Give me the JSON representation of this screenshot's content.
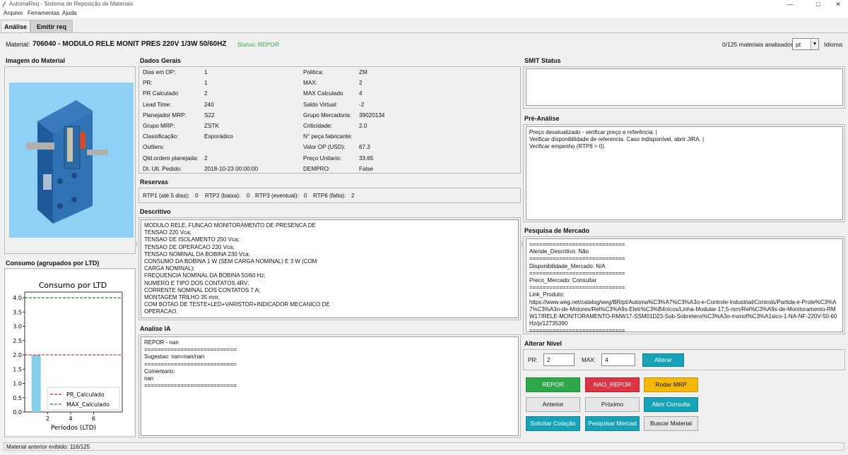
{
  "window": {
    "title": "AutomaReq - Sistema de Reposição de Materiais"
  },
  "menu": [
    "Arquivo",
    "Ferramentas",
    "Ajuda"
  ],
  "tabs": [
    "Análise",
    "Emitir req"
  ],
  "header": {
    "material_label": "Material:",
    "material_title": "706040 - MODULO RELE MONIT PRES 220V 1/3W 50/60HZ",
    "status": "Status: REPOR",
    "progress": "0/125 materiais analisados",
    "language_value": "pt",
    "language_label": "Idioma:"
  },
  "sections": {
    "image": "Imagem do Material",
    "consumption": "Consumo (agrupados por LTD)",
    "general": "Dados Gerais",
    "reserves": "Reservas",
    "description": "Descritivo",
    "ai": "Analise IA",
    "smit": "SMIT Status",
    "pre": "Pré-Análise",
    "market": "Pesquisa de Mercado",
    "level": "Alterar Nível"
  },
  "general_left": [
    {
      "label": "Dias em OP:",
      "value": "1"
    },
    {
      "label": "PR:",
      "value": "1"
    },
    {
      "label": "PR Calculado",
      "value": "2"
    },
    {
      "label": "Lead Time:",
      "value": "240"
    },
    {
      "label": "Planejador MRP:",
      "value": "S22"
    },
    {
      "label": "Grupo MRP:",
      "value": "ZSTK"
    },
    {
      "label": "Classificação:",
      "value": "Esporádico"
    },
    {
      "label": "Outliers:",
      "value": ""
    },
    {
      "label": "Qtd.ordem planejada:",
      "value": "2"
    },
    {
      "label": "Dt. Ult. Pedido:",
      "value": "2018-10-23 00:00:00"
    }
  ],
  "general_right": [
    {
      "label": "Politica:",
      "value": "ZM"
    },
    {
      "label": "MAX:",
      "value": "2"
    },
    {
      "label": "MAX Calculado",
      "value": "4"
    },
    {
      "label": "Saldo Virtual:",
      "value": "-2"
    },
    {
      "label": "Grupo Mercadoria:",
      "value": "39020134"
    },
    {
      "label": "Criticidade:",
      "value": "2.0"
    },
    {
      "label": "N° peça fabricante:",
      "value": ""
    },
    {
      "label": "Valor OP (USD):",
      "value": "67.3"
    },
    {
      "label": "Preço Unitario:",
      "value": "33.65"
    },
    {
      "label": "DEMPRO:",
      "value": "False"
    }
  ],
  "reserves": [
    {
      "label": "RTP1 (até 5 dias):",
      "value": "0"
    },
    {
      "label": "RTP2 (baixa):",
      "value": "0"
    },
    {
      "label": "RTP3 (eventual):",
      "value": "0"
    },
    {
      "label": "RTP6 (falta):",
      "value": "2"
    }
  ],
  "description_text": "MODULO RELE, FUNCAO MONITORAMENTO DE PRESENCA DE\nTENSAO 220 Vca;\nTENSAO DE ISOLAMENTO 250 Vca;\nTENSAO DE OPERACAO 220 Vca;\nTENSAO NOMINAL DA BOBINA 230 Vca;\nCONSUMO DA BOBINA 1 W (SEM CARGA NOMINAL) E 3 W (COM\nCARGA NOMINAL);\nFREQUENCIA NOMINAL DA BOBINA 50/60 Hz;\nNUMERO E TIPO DOS CONTATOS 4RV;\nCORRENTE NOMINAL DOS CONTATOS 7 A;\nMONTAGEM TRILHO 35 mm;\nCOM BOTAO DE TESTE+LED+VARISTOR+INDICADOR MECANICO DE\nOPERACAO.",
  "ai_text": "REPOR - nan\n============================\nSugestao: nan=nan/nan\n============================\nComentario:\nnan\n============================",
  "smit_text": "",
  "pre_text": "Preço desatualizado - verificar preço e referência. |\nVerificar disponibilidade de referencia. Caso indisponível, abrir JIRA. |\nVerificar empenho (RTP6 > 0).",
  "market_text": "=============================\nAtende_Descritivo: Não\n=============================\nDisponibilidade_Mercado: N/A\n=============================\nPreco_Mercado: Consultar\n=============================\nLink_Produto:\nhttps://www.weg.net/catalog/weg/BR/pt/Automa%C3%A7%C3%A3o-e-Controle-Industrial/Controls/Partida-e-Prote%C3%A7%C3%A3o-de-Motores/Rel%C3%A9s-Eletr%C3%B4nicos/Linha-Modular-17,5-mm/Rel%C3%A9s-de-Monitoramento-RMW17/RELE-MONITORAMENTO-RMW17-SSM01D23-Sub-Sobretens%C3%A3o-monof%C3%A1sico-1-NA-NF-220V-50-60Hz/p/12735390\n=============================",
  "level": {
    "pr_label": "PR:",
    "pr_value": "2",
    "max_label": "MAX:",
    "max_value": "4",
    "alter_label": "Alterar"
  },
  "buttons": {
    "repor": "REPOR",
    "nao_repor": "NAO_REPOR",
    "rodar_mrp": "Rodar MRP",
    "anterior": "Anterior",
    "proximo": "Próximo",
    "abrir_consulta": "Abrir Consulta",
    "solicitar_cotacao": "Solicitar Cotação",
    "pesquisar_mercado": "Pesquisar Mercad",
    "buscar_material": "Buscar Material"
  },
  "status_bar": "Material anterior exibido: 116/125",
  "colors": {
    "status_green": "#3aa34a",
    "repor": "#2ea84a",
    "nao_repor": "#dc3545",
    "rodar_mrp": "#f5b70a",
    "teal": "#17a2b8",
    "bar": "#87ceeb"
  },
  "chart_data": {
    "type": "bar",
    "title": "Consumo por LTD",
    "xlabel": "Períodos (LTD)",
    "ylabel": "",
    "x": [
      1
    ],
    "values": [
      2.0
    ],
    "xlim": [
      0,
      8.5
    ],
    "ylim": [
      0,
      4.2
    ],
    "xticks": [
      "2",
      "4",
      "6"
    ],
    "yticks": [
      "0.0",
      "0.5",
      "1.0",
      "1.5",
      "2.0",
      "2.5",
      "3.0",
      "3.5",
      "4.0"
    ],
    "reference_lines": [
      {
        "name": "PR_Calculado",
        "value": 2,
        "color": "#cc2222",
        "style": "dashed"
      },
      {
        "name": "MAX_Calculado",
        "value": 4,
        "color": "#228822",
        "style": "dashed"
      }
    ],
    "legend": "bottom-right",
    "grid": false
  }
}
